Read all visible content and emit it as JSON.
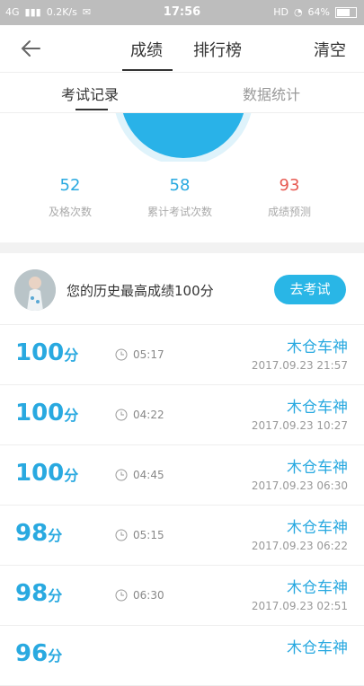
{
  "status": {
    "network": "4G",
    "speed": "0.2K/s",
    "time": "17:56",
    "hd": "HD",
    "battery": "64%"
  },
  "header": {
    "tabs": [
      "成绩",
      "排行榜"
    ],
    "clear": "清空"
  },
  "subtabs": [
    "考试记录",
    "数据统计"
  ],
  "stats": [
    {
      "value": "52",
      "label": "及格次数",
      "color": "#29a9e0"
    },
    {
      "value": "58",
      "label": "累计考试次数",
      "color": "#29a9e0"
    },
    {
      "value": "93",
      "label": "成绩预测",
      "color": "#e75a52"
    }
  ],
  "best": {
    "text": "您的历史最高成绩100分",
    "button": "去考试"
  },
  "records": [
    {
      "score": "100",
      "unit": "分",
      "duration": "05:17",
      "name": "木仓车神",
      "date": "2017.09.23  21:57"
    },
    {
      "score": "100",
      "unit": "分",
      "duration": "04:22",
      "name": "木仓车神",
      "date": "2017.09.23  10:27"
    },
    {
      "score": "100",
      "unit": "分",
      "duration": "04:45",
      "name": "木仓车神",
      "date": "2017.09.23  06:30"
    },
    {
      "score": "98",
      "unit": "分",
      "duration": "05:15",
      "name": "木仓车神",
      "date": "2017.09.23  06:22"
    },
    {
      "score": "98",
      "unit": "分",
      "duration": "06:30",
      "name": "木仓车神",
      "date": "2017.09.23  02:51"
    },
    {
      "score": "96",
      "unit": "分",
      "duration": "",
      "name": "木仓车神",
      "date": ""
    }
  ]
}
